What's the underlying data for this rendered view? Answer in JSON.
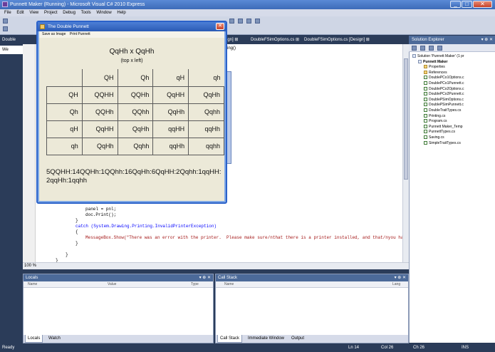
{
  "window": {
    "title": "Punnett Maker (Running) - Microsoft Visual C# 2010 Express",
    "min_label": "_",
    "max_label": "□",
    "close_label": "✕"
  },
  "menu": [
    "File",
    "Edit",
    "View",
    "Project",
    "Debug",
    "Tools",
    "Window",
    "Help"
  ],
  "doc_tabs": [
    {
      "label": "Double"
    },
    {
      "label": "sign] ⊞"
    },
    {
      "label": "DoubleFSimOptions.cs ⊞"
    },
    {
      "label": "DoubleFSimOptions.cs [Design] ⊞"
    }
  ],
  "left_tabs": [
    "We"
  ],
  "editor": {
    "method_combo": "nting()",
    "lines": [
      {
        "text": "panel = pnl;"
      },
      {
        "text": "doc.Print();"
      },
      {
        "text": "}"
      },
      {
        "text": "catch (System.Drawing.Printing.InvalidPrinterException)"
      },
      {
        "text": "{"
      },
      {
        "text": "MessageBox.Show(\"There was an error with the printer.  Please make sure/nthat there is a printer installed, and that/nyou have y"
      },
      {
        "text": "}"
      },
      {
        "text": "}"
      },
      {
        "text": "}"
      }
    ],
    "zoom": "100 %"
  },
  "solution_explorer": {
    "title": "Solution Explorer",
    "pin": "▾ ⊕ ✕",
    "nodes": [
      {
        "label": "Solution 'Punnett Maker' (1 pr",
        "indent": 0,
        "icon": "solution-icon"
      },
      {
        "label": "Punnett Maker",
        "indent": 1,
        "icon": "project-icon",
        "bold": true
      },
      {
        "label": "Properties",
        "indent": 2,
        "icon": "folder-icon"
      },
      {
        "label": "References",
        "indent": 2,
        "icon": "folder-icon"
      },
      {
        "label": "DoublePCo1Options.c",
        "indent": 2,
        "icon": "cs-file-icon"
      },
      {
        "label": "DoublePCo1Punnett.c",
        "indent": 2,
        "icon": "cs-file-icon"
      },
      {
        "label": "DoublePCo2Options.c",
        "indent": 2,
        "icon": "cs-file-icon"
      },
      {
        "label": "DoublePCo2Punnett.c",
        "indent": 2,
        "icon": "cs-file-icon"
      },
      {
        "label": "DoublePSimOptions.c",
        "indent": 2,
        "icon": "cs-file-icon"
      },
      {
        "label": "DoublePSimPunnett.c",
        "indent": 2,
        "icon": "cs-file-icon"
      },
      {
        "label": "DoubleTraitTypes.cs",
        "indent": 2,
        "icon": "cs-file-icon"
      },
      {
        "label": "Printing.cs",
        "indent": 2,
        "icon": "cs-file-icon"
      },
      {
        "label": "Program.cs",
        "indent": 2,
        "icon": "cs-file-icon"
      },
      {
        "label": "Punnett Maker_Temp",
        "indent": 2,
        "icon": "cs-file-icon"
      },
      {
        "label": "PunnettTypes.cs",
        "indent": 2,
        "icon": "cs-file-icon"
      },
      {
        "label": "Saving.cs",
        "indent": 2,
        "icon": "cs-file-icon"
      },
      {
        "label": "SimpleTraitTypes.cs",
        "indent": 2,
        "icon": "cs-file-icon"
      }
    ]
  },
  "locals": {
    "title": "Locals",
    "pin": "▾ ⊕ ✕",
    "columns": [
      "Name",
      "Value",
      "Type"
    ],
    "tabs": [
      "Locals",
      "Watch"
    ]
  },
  "callstack": {
    "title": "Call Stack",
    "pin": "▾ ⊕ ✕",
    "columns": [
      "Name",
      "Lang"
    ],
    "tabs": [
      "Call Stack",
      "Immediate Window",
      "Output"
    ]
  },
  "status": {
    "text": "Ready",
    "ln": "Ln 14",
    "col": "Col 26",
    "ch": "Ch 26",
    "ins": "INS"
  },
  "dialog": {
    "title": "The Double Punnett",
    "menu": [
      "Save as Image",
      "Print Punnett"
    ],
    "cross": "QqHh x QqHh",
    "subtitle": "(top x left)",
    "col_headers": [
      "QH",
      "Qh",
      "qH",
      "qh"
    ],
    "rows": [
      {
        "header": "QH",
        "cells": [
          "QQHH",
          "QQHh",
          "QqHH",
          "QqHh"
        ]
      },
      {
        "header": "Qh",
        "cells": [
          "QQHh",
          "QQhh",
          "QqHh",
          "Qqhh"
        ]
      },
      {
        "header": "qH",
        "cells": [
          "QqHH",
          "QqHh",
          "qqHH",
          "qqHh"
        ]
      },
      {
        "header": "qh",
        "cells": [
          "QqHh",
          "Qqhh",
          "qqHh",
          "qqhh"
        ]
      }
    ],
    "ratio": "5QQHH:14QQHh:1QQhh:16QqHh:6QqHH:2Qqhh:1qqHH:2qqHh:1qqhh"
  }
}
